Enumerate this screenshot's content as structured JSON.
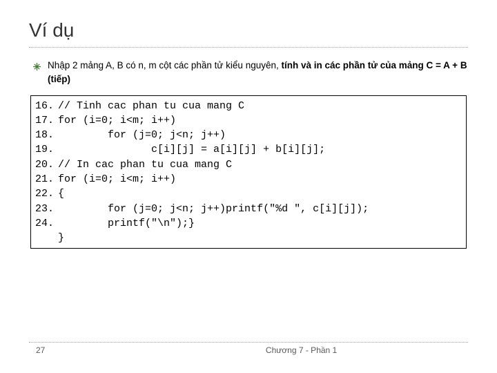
{
  "title": "Ví dụ",
  "bullet": {
    "plain": "Nhập 2 mảng A, B có n, m cột các phần tử kiểu nguyên, ",
    "bold": "tính và in các phần tử của mảng C = A + B (tiếp)"
  },
  "code": {
    "line_nums": "16.\n17.\n18.\n19.\n20.\n21.\n22.\n23.\n24.",
    "body": "// Tinh cac phan tu cua mang C\nfor (i=0; i<m; i++)\n        for (j=0; j<n; j++)\n               c[i][j] = a[i][j] + b[i][j];\n// In cac phan tu cua mang C\nfor (i=0; i<m; i++)\n{\n        for (j=0; j<n; j++)printf(\"%d \", c[i][j]);\n        printf(\"\\n\");}\n}"
  },
  "footer": {
    "page": "27",
    "caption": "Chương 7 - Phần 1"
  }
}
